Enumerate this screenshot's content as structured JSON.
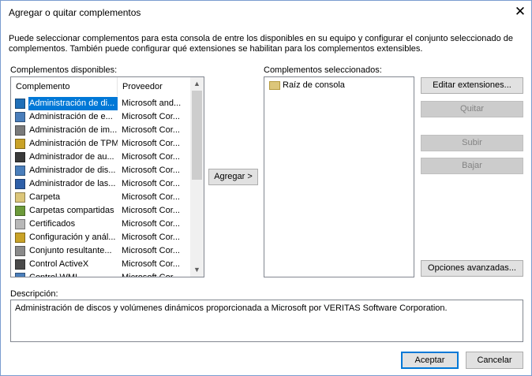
{
  "window": {
    "title": "Agregar o quitar complementos",
    "close_glyph": "✕"
  },
  "intro_text": "Puede seleccionar complementos para esta consola de entre los disponibles en su equipo y configurar el conjunto seleccionado de complementos. También puede configurar qué extensiones se habilitan para los complementos extensibles.",
  "available": {
    "label": "Complementos disponibles:",
    "col_name": "Complemento",
    "col_provider": "Proveedor",
    "items": [
      {
        "name": "Administración de di...",
        "provider": "Microsoft and...",
        "icon": "disk-management-icon",
        "color": "#1f6fb8"
      },
      {
        "name": "Administración de e...",
        "provider": "Microsoft Cor...",
        "icon": "computer-management-icon",
        "color": "#4a7ebb"
      },
      {
        "name": "Administración de im...",
        "provider": "Microsoft Cor...",
        "icon": "print-management-icon",
        "color": "#7a7a7a"
      },
      {
        "name": "Administración de TPM",
        "provider": "Microsoft Cor...",
        "icon": "tpm-key-icon",
        "color": "#c9a227"
      },
      {
        "name": "Administrador de au...",
        "provider": "Microsoft Cor...",
        "icon": "authorization-manager-icon",
        "color": "#3a3a3a"
      },
      {
        "name": "Administrador de dis...",
        "provider": "Microsoft Cor...",
        "icon": "device-manager-icon",
        "color": "#4a7ebb"
      },
      {
        "name": "Administrador de las...",
        "provider": "Microsoft Cor...",
        "icon": "policy-manager-icon",
        "color": "#2e5fa8"
      },
      {
        "name": "Carpeta",
        "provider": "Microsoft Cor...",
        "icon": "folder-icon",
        "color": "#dcc67a"
      },
      {
        "name": "Carpetas compartidas",
        "provider": "Microsoft Cor...",
        "icon": "shared-folders-icon",
        "color": "#6c9a3a"
      },
      {
        "name": "Certificados",
        "provider": "Microsoft Cor...",
        "icon": "certificates-icon",
        "color": "#b8b8b8"
      },
      {
        "name": "Configuración y anál...",
        "provider": "Microsoft Cor...",
        "icon": "security-configuration-icon",
        "color": "#c9a227"
      },
      {
        "name": "Conjunto resultante...",
        "provider": "Microsoft Cor...",
        "icon": "resultant-set-icon",
        "color": "#8a8a8a"
      },
      {
        "name": "Control ActiveX",
        "provider": "Microsoft Cor...",
        "icon": "activex-control-icon",
        "color": "#4a4a4a"
      },
      {
        "name": "Control WMI",
        "provider": "Microsoft Cor...",
        "icon": "wmi-control-icon",
        "color": "#4a7ebb"
      }
    ],
    "selected_index": 0
  },
  "add_button": "Agregar >",
  "selected": {
    "label": "Complementos seleccionados:",
    "items": [
      {
        "name": "Raíz de consola",
        "icon": "folder-icon"
      }
    ]
  },
  "buttons": {
    "edit_extensions": "Editar extensiones...",
    "remove": "Quitar",
    "move_up": "Subir",
    "move_down": "Bajar",
    "advanced": "Opciones avanzadas..."
  },
  "description": {
    "label": "Descripción:",
    "text": "Administración de discos y volúmenes dinámicos proporcionada a Microsoft por VERITAS Software Corporation."
  },
  "footer": {
    "ok": "Aceptar",
    "cancel": "Cancelar"
  },
  "colors": {
    "selection": "#0078d7",
    "border": "#828790",
    "button": "#e1e1e1",
    "button_disabled": "#cccccc"
  }
}
